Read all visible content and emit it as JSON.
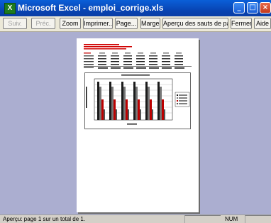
{
  "window": {
    "title": "Microsoft Excel - emploi_corrige.xls",
    "app_icon": "X"
  },
  "toolbar": {
    "next": "Suiv.",
    "prev": "Préc.",
    "zoom": "Zoom",
    "print": "Imprimer...",
    "setup": "Page...",
    "margins": "Marges",
    "page_break": "Aperçu des sauts de page",
    "close": "Fermer",
    "help": "Aide"
  },
  "status": {
    "text": "Aperçu: page 1 sur un total de 1.",
    "num": "NUM"
  }
}
